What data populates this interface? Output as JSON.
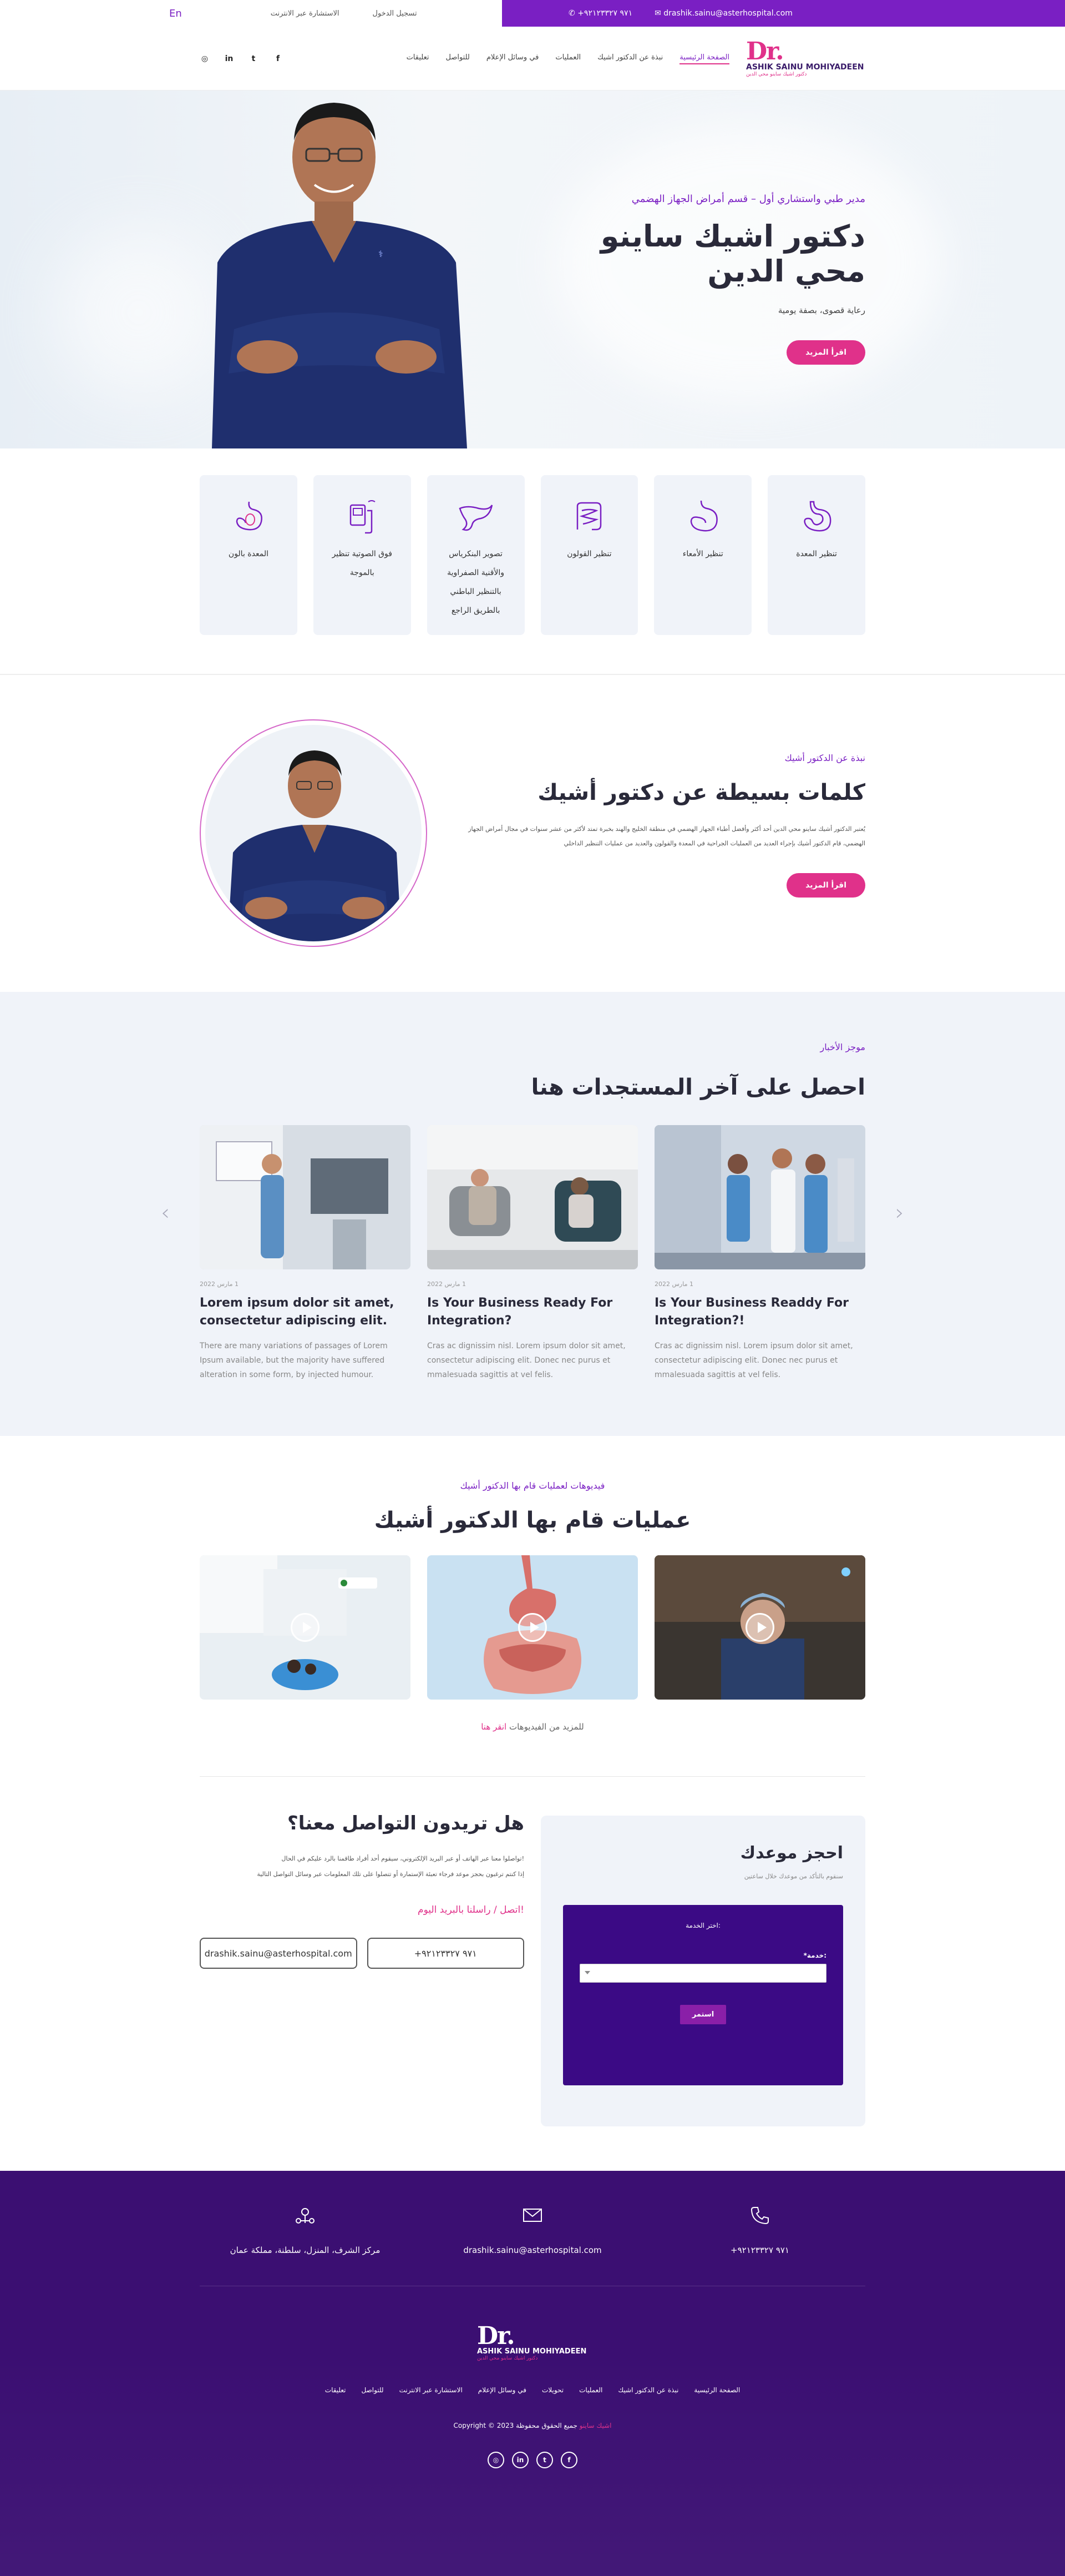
{
  "topbar": {
    "lang": "En",
    "consult": "الاستشارة عبر الانترنت",
    "login": "تسجيل الدخول",
    "phone": "+٩٧١ ٩٢١٢٣٣٢٧",
    "email": "drashik.sainu@asterhospital.com"
  },
  "nav": {
    "items": [
      "الصفحة الرئيسية",
      "نبذة عن الدكتور اشيك",
      "العمليات",
      "في وسائل الإعلام",
      "للتواصل",
      "تعليقات"
    ],
    "logo": {
      "dr": "Dr.",
      "name": "ASHIK SAINU MOHIYADEEN",
      "sub": "دكتور اشيك ساينو محي الدين"
    }
  },
  "hero": {
    "tag": "مدير طبي واستشاري أول – قسم أمراض الجهاز الهضمي",
    "title": "دكتور اشيك ساينو محي الدين",
    "desc": "رعاية قصوى، بصفة يومية",
    "btn": "اقرأ المزيد"
  },
  "services": [
    {
      "label": "تنظير المعدة",
      "icon": "stomach-icon"
    },
    {
      "label": "تنظير الأمعاء",
      "icon": "intestine-icon"
    },
    {
      "label": "تنظير القولون",
      "icon": "colon-icon"
    },
    {
      "label": "تصوير البنكرياس والأقنية الصفراوية بالتنظير الباطني بالطريق الراجع",
      "icon": "pancreas-icon"
    },
    {
      "label": "فوق الصوتية تنظير بالموجة",
      "icon": "ultrasound-icon"
    },
    {
      "label": "المعدة بالون",
      "icon": "balloon-icon"
    }
  ],
  "about": {
    "tag": "نبذة عن الدكتور أشيك",
    "title": "كلمات بسيطة عن دكتور أشيك",
    "desc": "يُعتبر الدكتور أشيك ساينو محي الدين أحد أكثر وأفضل أطباء الجهاز الهضمي في منطقة الخليج والهند بخبرة تمتد لأكثر من عشر سنوات في مجال أمراض الجهاز الهضمي، قام الدكتور أشيك بإجراء العديد من العمليات الجراحية في المعدة والقولون والعديد من عمليات التنظير الداخلي",
    "btn": "اقرأ المزيد"
  },
  "news": {
    "tag": "موجز الأخبار",
    "title": "احصل على آخر المستجدات هنا",
    "cards": [
      {
        "date": "1 مارس 2022",
        "title": "Is Your Business Readdy For Integration?!",
        "excerpt": "Cras ac dignissim nisl. Lorem ipsum dolor sit amet, consectetur adipiscing elit. Donec nec purus et mmalesuada sagittis at vel felis."
      },
      {
        "date": "1 مارس 2022",
        "title": "Is Your Business Ready For Integration?",
        "excerpt": "Cras ac dignissim nisl. Lorem ipsum dolor sit amet, consectetur adipiscing elit. Donec nec purus et mmalesuada sagittis at vel felis."
      },
      {
        "date": "1 مارس 2022",
        "title": "Lorem ipsum dolor sit amet, consectetur adipiscing elit.",
        "excerpt": "There are many variations of passages of Lorem Ipsum available, but the majority have suffered alteration in some form, by injected humour."
      }
    ]
  },
  "videos": {
    "tag": "فيديوهات لعمليات قام بها الدكتور أشيك",
    "title": "عمليات قام بها الدكتور أشيك",
    "more_link": "انقر هنا",
    "more_text": "للمزيد من الفيديوهات"
  },
  "contact": {
    "title": "هل تريدون التواصل معنا؟",
    "p1": "تواصلوا معنا عبر الهاتف أو عبر البريد الإلكتروني، سيقوم أحد أفراد طاقمنا بالرد عليكم في الحال!",
    "p2": "إذا كنتم ترغبون بحجز موعد فرجاء تعبئة الإستمارة أو تتصلوا على تلك المعلومات عبر وسائل التواصل التالية",
    "mail_heading": "اتصل / راسلنا بالبريد اليوم!",
    "email_btn": "drashik.sainu@asterhospital.com",
    "phone_btn": "+٩٧١ ٩٢١٢٣٣٢٧",
    "booking": {
      "title": "احجز موعدك",
      "sub": "سنقوم بالتأكد من موعدك خلال ساعتين",
      "form_title": "اختر الخدمة:",
      "field_label": "*خدمة:",
      "submit": "استمر"
    }
  },
  "footer": {
    "phone": "+٩٧١ ٩٢١٢٣٣٢٧",
    "email": "drashik.sainu@asterhospital.com",
    "address": "مركز الشرف، المنزل، سلطنة، مملكة عمان",
    "logo": {
      "dr": "Dr.",
      "name": "ASHIK SAINU MOHIYADEEN",
      "sub": "دكتور اشيك ساينو محي الدين"
    },
    "menu": [
      "الصفحة الرئيسية",
      "نبذة عن الدكتور اشيك",
      "العمليات",
      "تحويلات",
      "في وسائل الإعلام",
      "الاستشارة عبر الانترنت",
      "للتواصل",
      "تعليقات"
    ],
    "copy_prefix": "Copyright © 2023",
    "copy_mid": "جميع الحقوق محفوظة",
    "copy_name": "اشيك ساينو"
  },
  "colors": {
    "primary": "#7a1fc3",
    "accent": "#e0318a",
    "dark": "#3b0f72",
    "light_bg": "#f0f3f9"
  }
}
